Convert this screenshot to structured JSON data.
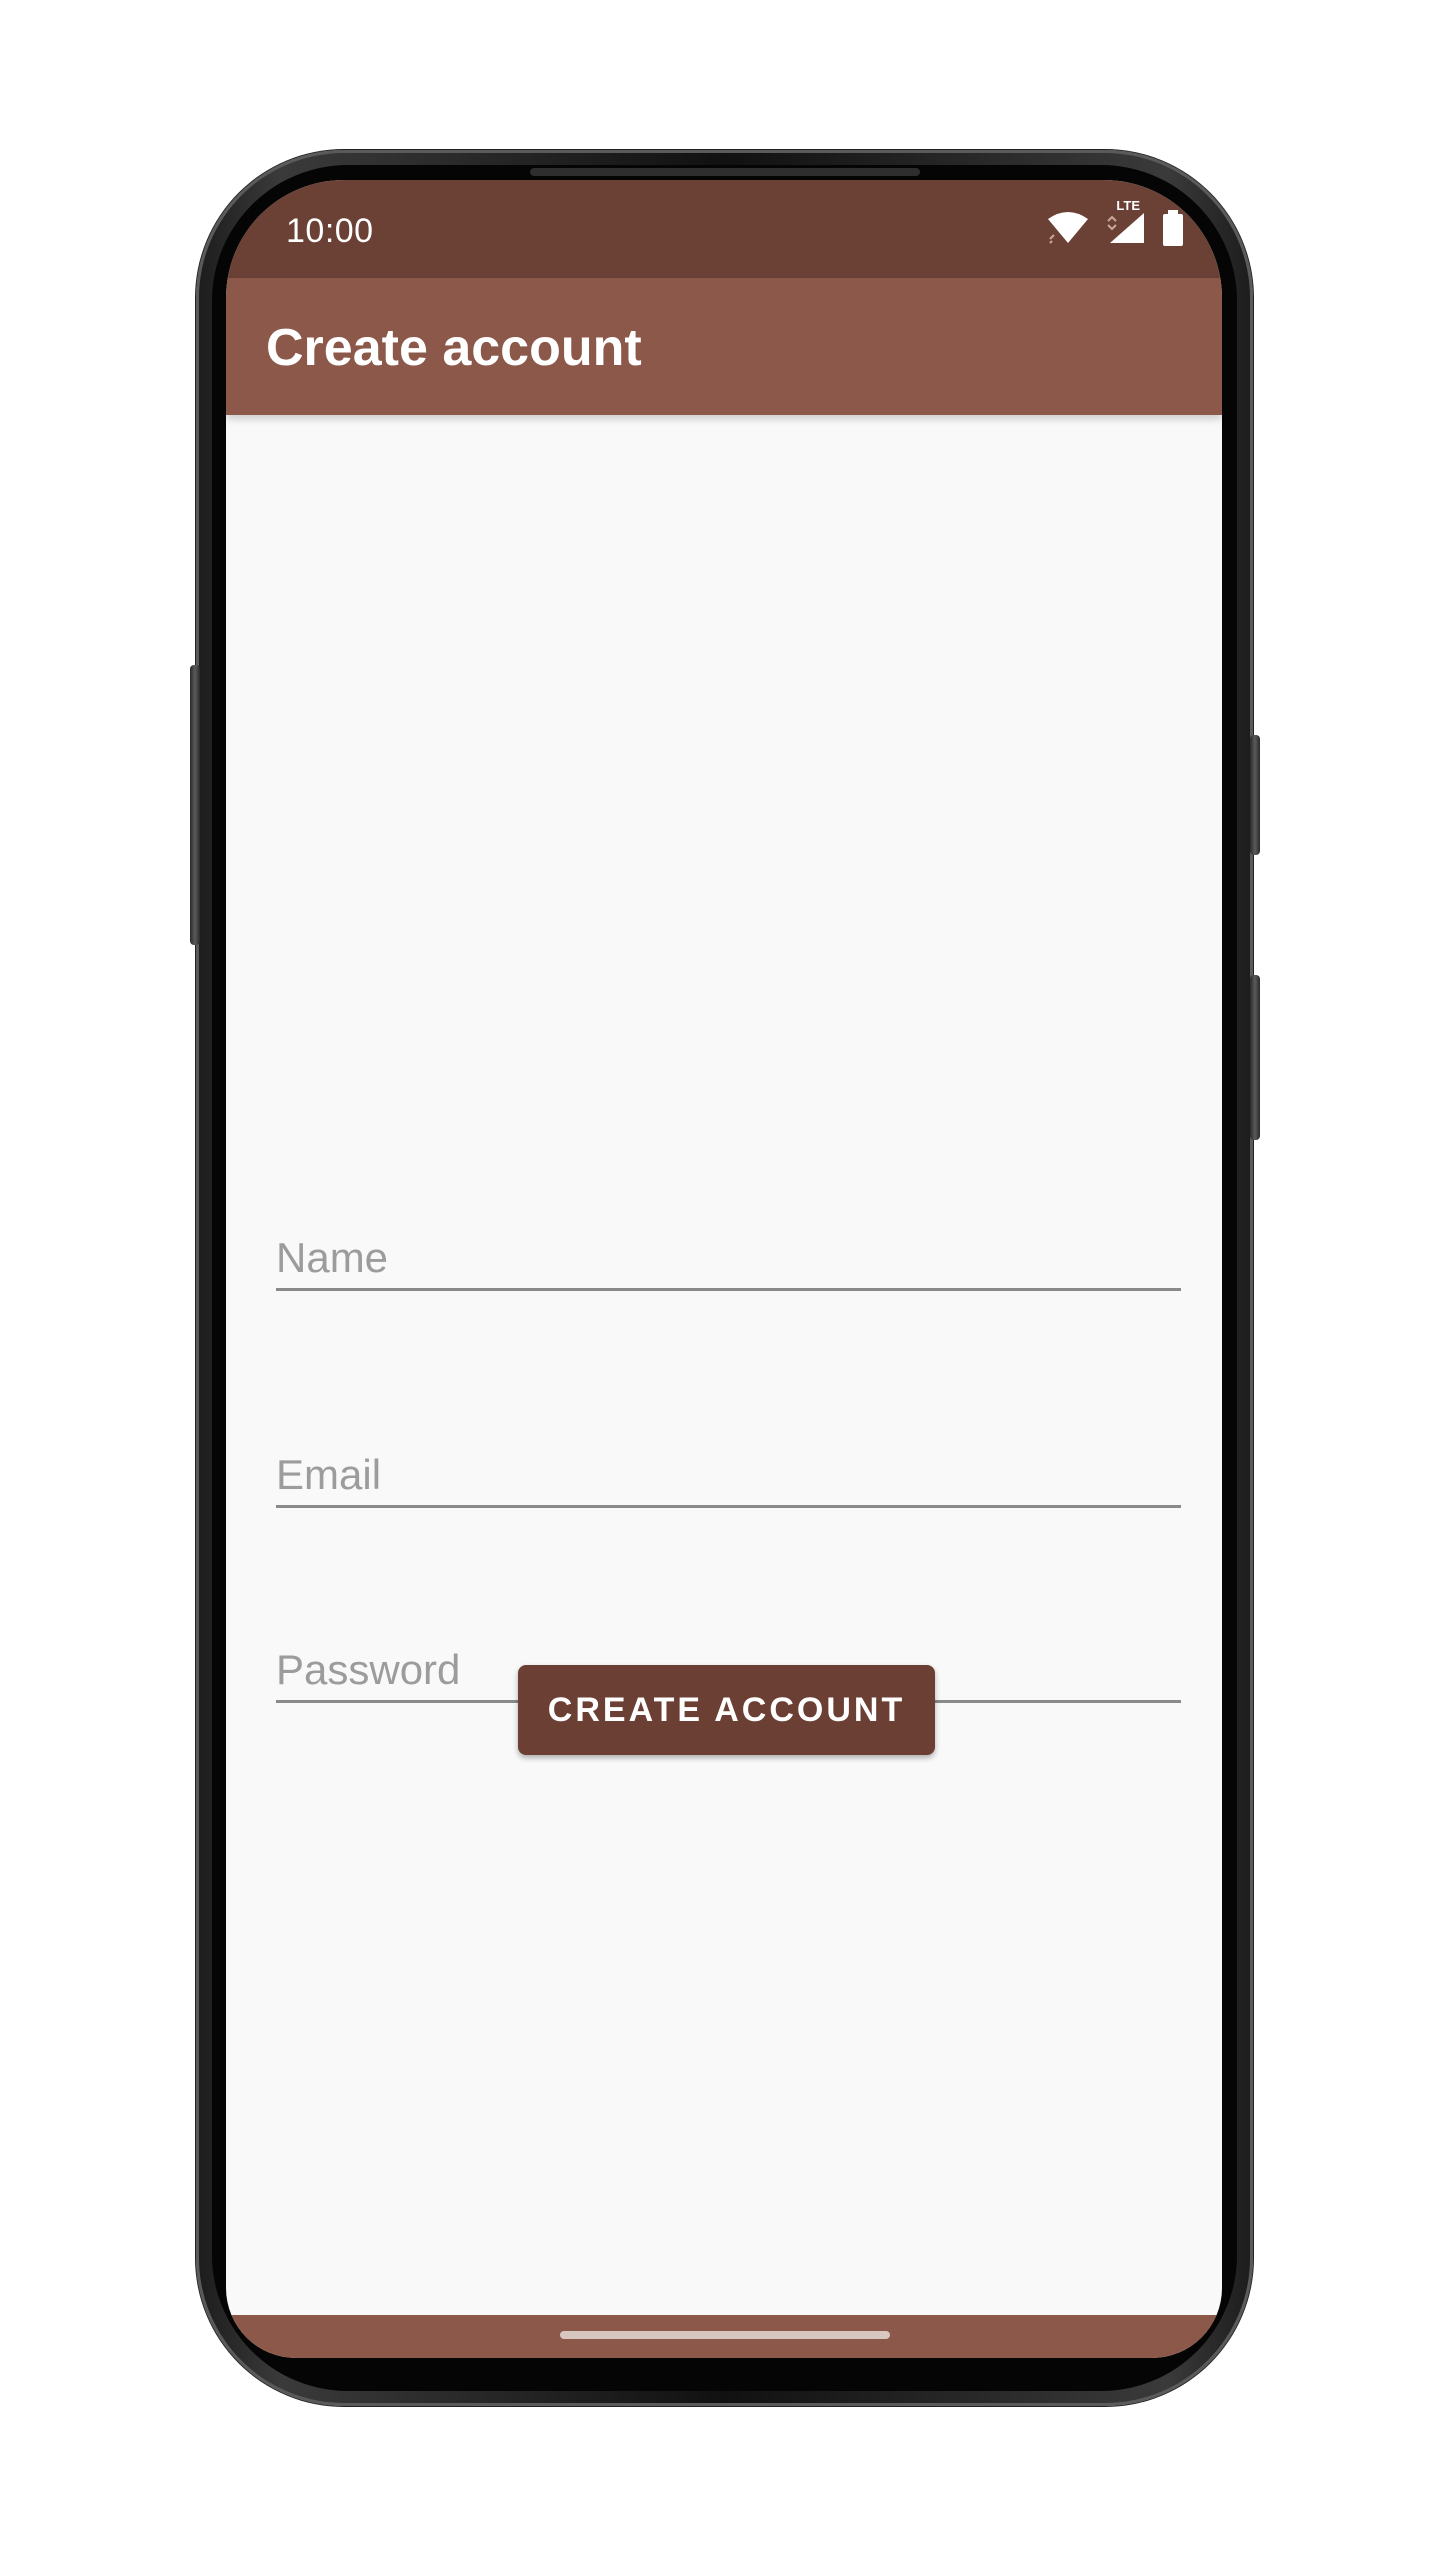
{
  "status_bar": {
    "time": "10:00",
    "network_label": "LTE",
    "icons": [
      "wifi-icon",
      "signal-icon",
      "battery-icon"
    ]
  },
  "app_bar": {
    "title": "Create account"
  },
  "form": {
    "name_placeholder": "Name",
    "email_placeholder": "Email",
    "password_placeholder": "Password",
    "submit_label": "CREATE ACCOUNT"
  },
  "colors": {
    "status_bar": "#6b4136",
    "app_bar": "#8b584a",
    "button": "#6b3f34",
    "background": "#f9f9f9"
  }
}
